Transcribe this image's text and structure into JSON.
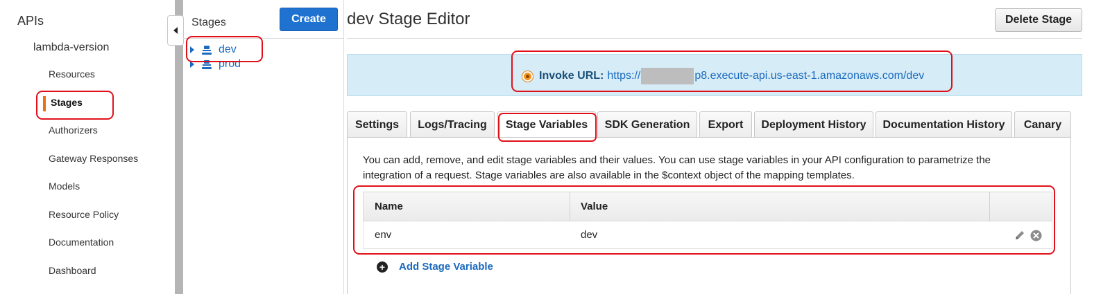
{
  "nav": {
    "apis_label": "APIs",
    "api_name": "lambda-version",
    "items": [
      {
        "label": "Resources",
        "active": false
      },
      {
        "label": "Stages",
        "active": true
      },
      {
        "label": "Authorizers",
        "active": false
      },
      {
        "label": "Gateway Responses",
        "active": false
      },
      {
        "label": "Models",
        "active": false
      },
      {
        "label": "Resource Policy",
        "active": false
      },
      {
        "label": "Documentation",
        "active": false
      },
      {
        "label": "Dashboard",
        "active": false
      }
    ],
    "accent_color": "#ec7211"
  },
  "stages_panel": {
    "title": "Stages",
    "create_label": "Create",
    "stages": [
      {
        "name": "dev",
        "icon": "stage-icon"
      },
      {
        "name": "prod",
        "icon": "stage-icon"
      }
    ]
  },
  "editor": {
    "title": "dev Stage Editor",
    "delete_label": "Delete Stage",
    "invoke": {
      "label": "Invoke URL:",
      "url_prefix": "https://",
      "url_suffix": "p8.execute-api.us-east-1.amazonaws.com/dev"
    },
    "tabs": [
      {
        "label": "Settings",
        "active": false
      },
      {
        "label": "Logs/Tracing",
        "active": false
      },
      {
        "label": "Stage Variables",
        "active": true
      },
      {
        "label": "SDK Generation",
        "active": false
      },
      {
        "label": "Export",
        "active": false
      },
      {
        "label": "Deployment History",
        "active": false
      },
      {
        "label": "Documentation History",
        "active": false
      },
      {
        "label": "Canary",
        "active": false
      }
    ],
    "stage_variables": {
      "description": "You can add, remove, and edit stage variables and their values. You can use stage variables in your API configuration to parametrize the integration of a request. Stage variables are also available in the $context object of the mapping templates.",
      "columns": [
        "Name",
        "Value"
      ],
      "rows": [
        {
          "name": "env",
          "value": "dev"
        }
      ],
      "add_label": "Add Stage Variable"
    }
  },
  "colors": {
    "primary_button": "#1f72d0",
    "link": "#1a6ac0",
    "info_bg": "#d6ecf6",
    "highlight": "#e0101a"
  }
}
